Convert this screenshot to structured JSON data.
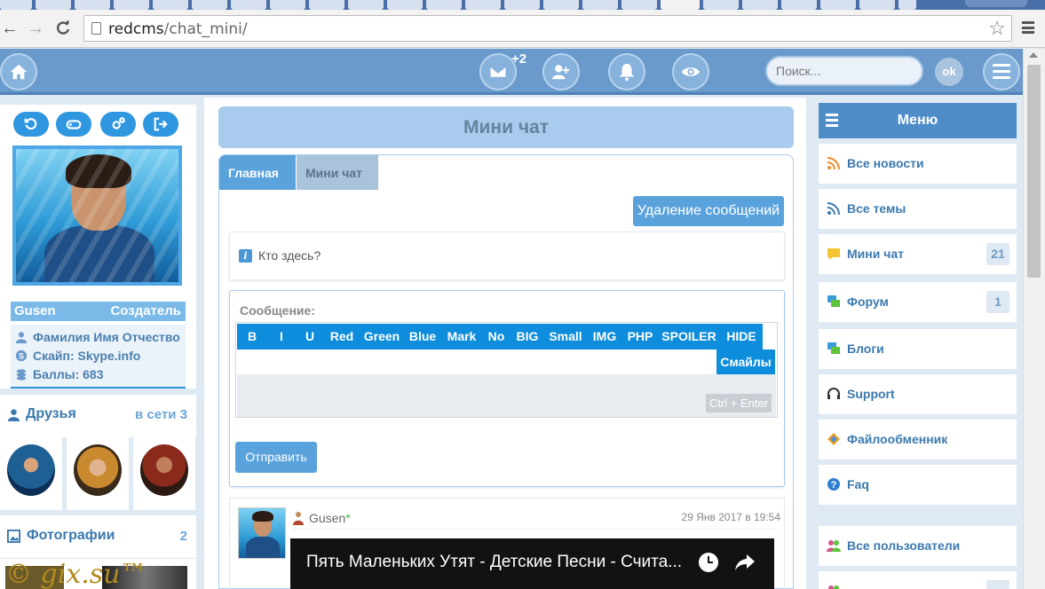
{
  "browser": {
    "url_host": "redcms",
    "url_path": "/chat_mini/",
    "star_glyph": "☆"
  },
  "topbar": {
    "messages_badge": "+2",
    "search_placeholder": "Поиск...",
    "search_button": "ok"
  },
  "profile": {
    "name": "Gusen",
    "role": "Создатель",
    "full_name": "Фамилия Имя Отчество",
    "skype": "Скайп: Skype.info",
    "points": "Баллы: 683"
  },
  "friends": {
    "title": "Друзья",
    "online": "в сети 3"
  },
  "photos": {
    "title": "Фотографии",
    "count": "2"
  },
  "watermark": "© gix.su™",
  "main": {
    "title": "Мини чат",
    "tabs": [
      {
        "label": "Главная"
      },
      {
        "label": "Мини чат"
      }
    ],
    "delete_button": "Удаление сообщений",
    "who_here": "Кто здесь?",
    "message_label": "Сообщение:",
    "toolbar": [
      "B",
      "I",
      "U",
      "Red",
      "Green",
      "Blue",
      "Mark",
      "No",
      "BIG",
      "Small",
      "IMG",
      "PHP",
      "SPOILER",
      "HIDE",
      "Смайлы"
    ],
    "ctrl_enter": "Ctrl + Enter",
    "send_button": "Отправить",
    "post": {
      "user": "Gusen",
      "online_mark": "*",
      "date": "29 Янв 2017 в 19:54",
      "video_title": "Пять Маленьких Утят - Детские Песни - Счита..."
    }
  },
  "menu": {
    "title": "Меню",
    "items": [
      {
        "label": "Все новости",
        "count": ""
      },
      {
        "label": "Все темы",
        "count": ""
      },
      {
        "label": "Мини чат",
        "count": "21"
      },
      {
        "label": "Форум",
        "count": "1"
      },
      {
        "label": "Блоги",
        "count": ""
      },
      {
        "label": "Support",
        "count": ""
      },
      {
        "label": "Файлообменник",
        "count": ""
      },
      {
        "label": "Faq",
        "count": ""
      },
      {
        "label": "Все пользователи",
        "count": ""
      }
    ]
  },
  "colors": {
    "accent": "#5aa2dc",
    "toolbar_blue": "#0d8ddb",
    "topbar": "#6a9acb"
  }
}
